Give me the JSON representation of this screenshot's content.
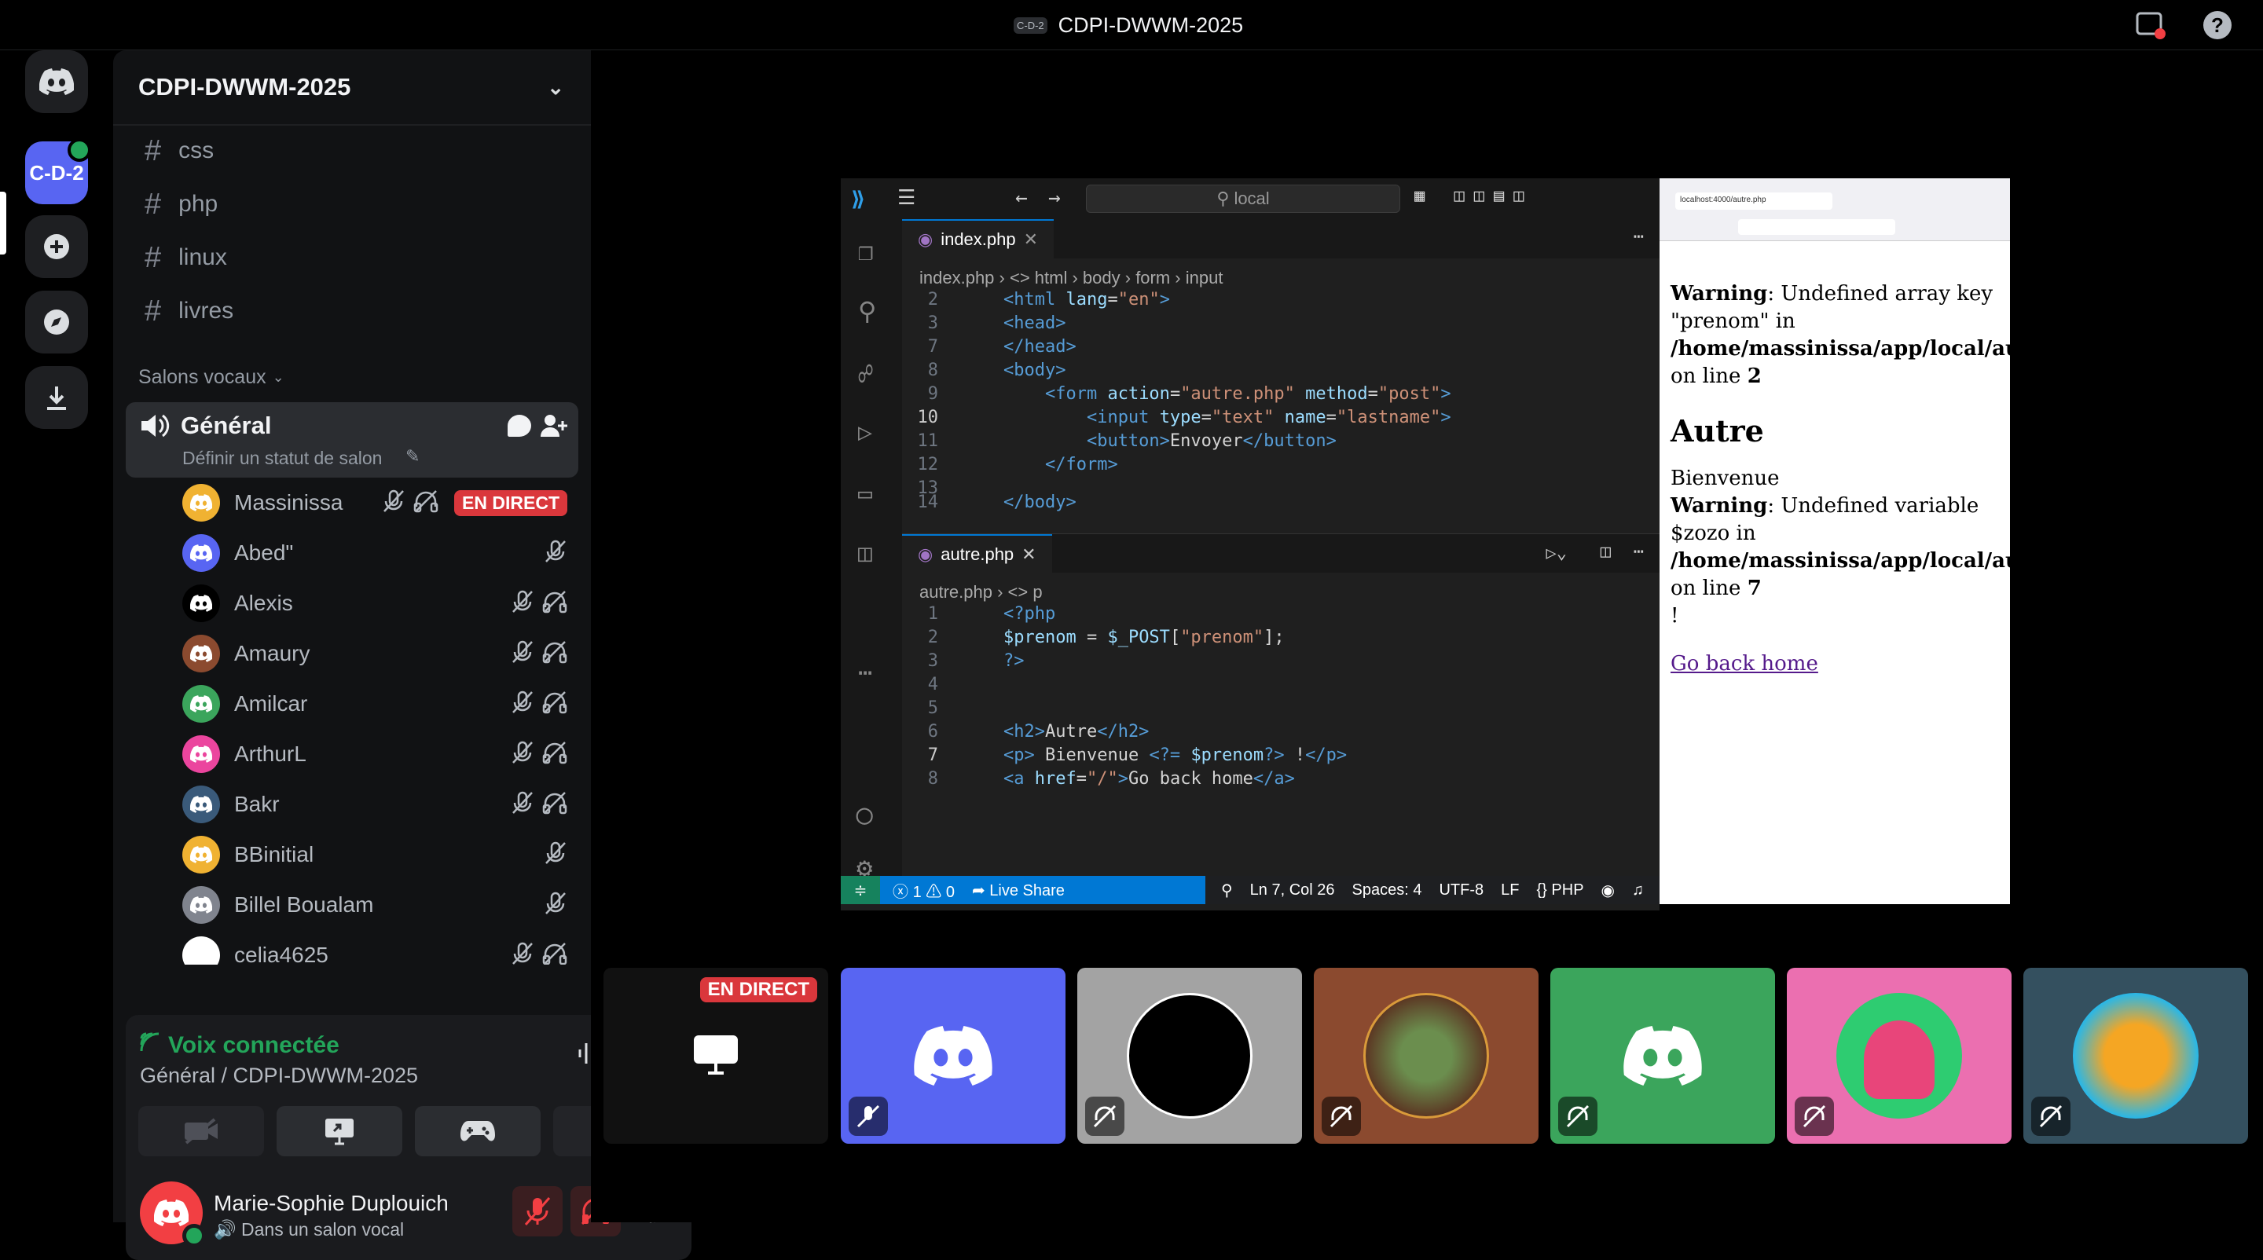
{
  "window": {
    "server_short": "C-D-2",
    "title": "CDPI-DWWM-2025"
  },
  "server_rail": {
    "active_server": "C-D-2"
  },
  "sidebar": {
    "server_name": "CDPI-DWWM-2025",
    "text_channels": [
      "css",
      "php",
      "linux",
      "livres"
    ],
    "voice_header": "Salons vocaux",
    "voice_channel": {
      "name": "Général",
      "status": "Définir un statut de salon"
    },
    "members": [
      {
        "name": "Massinissa",
        "live": "EN DIRECT",
        "color": "#f0b232"
      },
      {
        "name": "Abed\"",
        "color": "#5865f2"
      },
      {
        "name": "Alexis",
        "color": "#000000"
      },
      {
        "name": "Amaury",
        "color": "#8b4a2f"
      },
      {
        "name": "Amilcar",
        "color": "#3ba55c"
      },
      {
        "name": "ArthurL",
        "color": "#eb459e"
      },
      {
        "name": "Bakr",
        "color": "#3a5a7a"
      },
      {
        "name": "BBinitial",
        "color": "#f0b232"
      },
      {
        "name": "Billel Boualam",
        "color": "#80848e"
      },
      {
        "name": "celia4625",
        "color": "#ffffff"
      }
    ]
  },
  "voice_panel": {
    "status": "Voix connectée",
    "location": "Général / CDPI-DWWM-2025"
  },
  "user": {
    "name": "Marie-Sophie Duplouich",
    "status": "Dans un salon vocal"
  },
  "vscode": {
    "search": "local",
    "tab1": "index.php",
    "crumb1": [
      "index.php",
      "html",
      "body",
      "form",
      "input"
    ],
    "tab2": "autre.php",
    "crumb2": [
      "autre.php",
      "p"
    ],
    "status": {
      "errors": "1",
      "warnings": "0",
      "liveshare": "Live Share",
      "position": "Ln 7, Col 26",
      "spaces": "Spaces: 4",
      "encoding": "UTF-8",
      "eol": "LF",
      "lang": "PHP"
    }
  },
  "browser": {
    "url": "localhost:4000/autre.php",
    "warn1_label": "Warning",
    "warn1_text": ": Undefined array key \"prenom\" in ",
    "warn1_path": "/home/massinissa/app/local/autre.php",
    "warn1_line": " on line ",
    "warn1_num": "2",
    "heading": "Autre",
    "welcome": "Bienvenue",
    "warn2_label": "Warning",
    "warn2_text": ": Undefined variable $zozo in ",
    "warn2_path": "/home/massinissa/app/local/autre.php",
    "warn2_line": " on line ",
    "warn2_num": "7",
    "bang": "!",
    "link": "Go back home"
  },
  "stream_tile": {
    "live": "EN DIRECT"
  }
}
